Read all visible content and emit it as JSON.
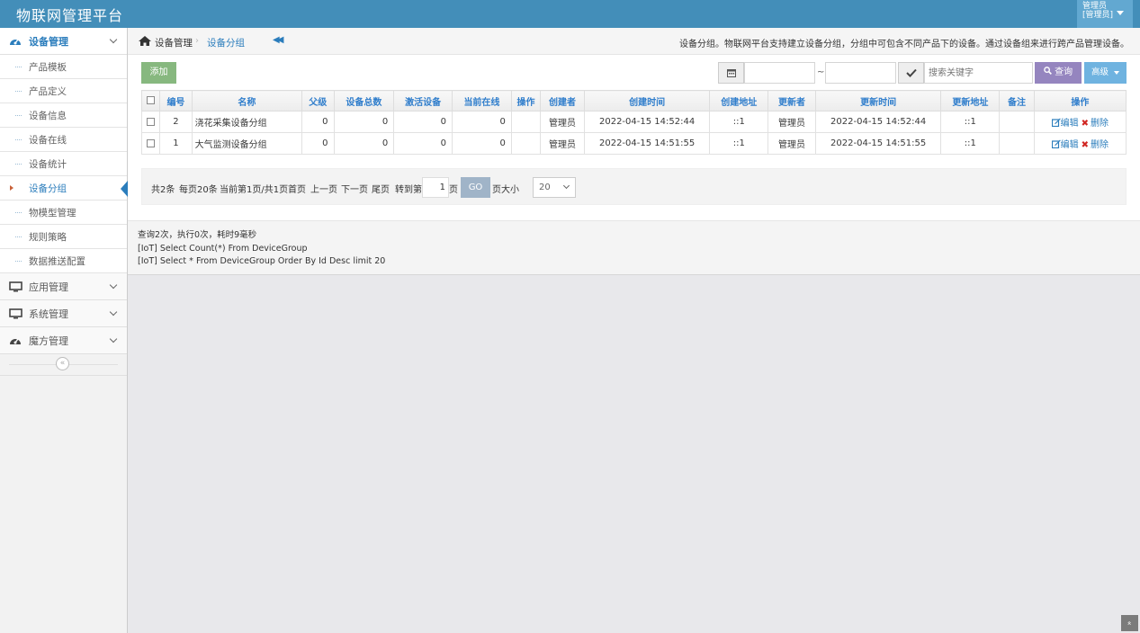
{
  "app": {
    "title": "物联网管理平台",
    "user_line1": "管理员",
    "user_line2": "[管理员]"
  },
  "sidebar": {
    "groups": [
      {
        "label": "设备管理",
        "icon": "dashboard-icon",
        "active": true
      },
      {
        "label": "应用管理",
        "icon": "desktop-icon"
      },
      {
        "label": "系统管理",
        "icon": "desktop-icon"
      },
      {
        "label": "魔方管理",
        "icon": "dashboard-icon"
      }
    ],
    "items": [
      {
        "label": "产品模板"
      },
      {
        "label": "产品定义"
      },
      {
        "label": "设备信息"
      },
      {
        "label": "设备在线"
      },
      {
        "label": "设备统计"
      },
      {
        "label": "设备分组",
        "active": true
      },
      {
        "label": "物模型管理"
      },
      {
        "label": "规则策略"
      },
      {
        "label": "数据推送配置"
      }
    ],
    "collapse_label": "«"
  },
  "breadcrumb": {
    "home": "设备管理",
    "separator": "›",
    "current": "设备分组",
    "toggle": "◀◀",
    "description": "设备分组。物联网平台支持建立设备分组，分组中可包含不同产品下的设备。通过设备组来进行跨产品管理设备。"
  },
  "toolbar": {
    "add": "添加",
    "tilde": "~",
    "search_placeholder": "搜索关键字",
    "query": "查询",
    "advanced": "高级"
  },
  "table": {
    "headers": [
      "编号",
      "名称",
      "父级",
      "设备总数",
      "激活设备",
      "当前在线",
      "操作",
      "创建者",
      "创建时间",
      "创建地址",
      "更新者",
      "更新时间",
      "更新地址",
      "备注",
      "操作"
    ],
    "rows": [
      {
        "id": "2",
        "name": "浇花采集设备分组",
        "parent": "0",
        "total": "0",
        "active": "0",
        "online": "0",
        "op": "",
        "creator": "管理员",
        "created": "2022-04-15 14:52:44",
        "created_ip": "::1",
        "updater": "管理员",
        "updated": "2022-04-15 14:52:44",
        "updated_ip": "::1",
        "remark": ""
      },
      {
        "id": "1",
        "name": "大气监测设备分组",
        "parent": "0",
        "total": "0",
        "active": "0",
        "online": "0",
        "op": "",
        "creator": "管理员",
        "created": "2022-04-15 14:51:55",
        "created_ip": "::1",
        "updater": "管理员",
        "updated": "2022-04-15 14:51:55",
        "updated_ip": "::1",
        "remark": ""
      }
    ],
    "edit": "编辑",
    "delete": "删除"
  },
  "pager": {
    "total": "共2条",
    "per_page": "每页20条",
    "current": "当前第1页/共1页",
    "first": "首页",
    "prev": "上一页",
    "next": "下一页",
    "last": "尾页",
    "goto": "转到第",
    "page_value": "1",
    "page_unit": "页",
    "go": "GO",
    "size_label": "页大小",
    "size_value": "20"
  },
  "log": {
    "line1": "查询2次，执行0次，耗时9毫秒",
    "line2": "[IoT] Select Count(*) From DeviceGroup",
    "line3": "[IoT] Select * From DeviceGroup Order By Id Desc limit 20"
  },
  "scroll_top": "»",
  "colors": {
    "topbar": "#438eb9",
    "accent": "#2b7dbc",
    "add": "#87b87f",
    "query": "#9585bf",
    "advanced": "#6fb3e0"
  }
}
